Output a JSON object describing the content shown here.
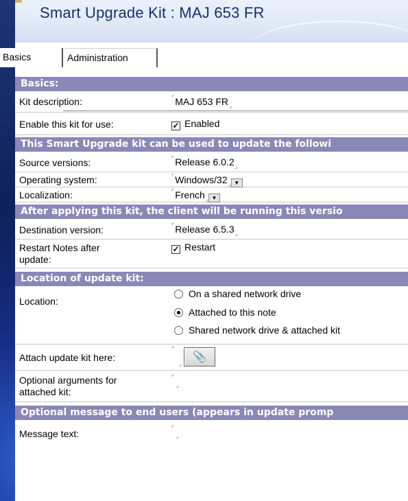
{
  "title": "Smart Upgrade Kit : MAJ 653 FR",
  "tabs": [
    {
      "label": "Basics"
    },
    {
      "label": "Administration"
    }
  ],
  "sections": {
    "basics": "Basics:",
    "update_following": "This Smart Upgrade kit can be used to update the followi",
    "client_version": "After applying this kit, the client will be running this versio",
    "location": "Location of update kit:",
    "optional_message": "Optional message to end users (appears in update promp"
  },
  "fields": {
    "kit_description": {
      "label": "Kit description:",
      "value": "MAJ 653 FR"
    },
    "enable_kit": {
      "label": "Enable this kit for use:",
      "option": "Enabled",
      "checked": true
    },
    "source_versions": {
      "label": "Source versions:",
      "value": "Release 6.0.2"
    },
    "operating_system": {
      "label": "Operating system:",
      "value": "Windows/32"
    },
    "localization": {
      "label": "Localization:",
      "value": "French"
    },
    "destination_version": {
      "label": "Destination version:",
      "value": "Release 6.5.3"
    },
    "restart_notes": {
      "label_line1": "Restart Notes after",
      "label_line2": "update:",
      "option": "Restart",
      "checked": true
    },
    "location": {
      "label": "Location:",
      "options": [
        "On a shared network drive",
        "Attached to this note",
        "Shared network drive & attached kit"
      ],
      "selected": "Attached to this note"
    },
    "attach_kit": {
      "label": "Attach update kit here:"
    },
    "optional_args": {
      "label_line1": "Optional arguments for",
      "label_line2": "attached kit:",
      "value": ""
    },
    "message_text": {
      "label": "Message text:",
      "value": ""
    }
  },
  "icons": {
    "dropdown": "dropdown-arrow-icon",
    "attach": "paperclip-attachment-icon",
    "checkmark": "checkmark-icon"
  },
  "colors": {
    "section_header_bg": "#8a88b6",
    "title_text": "#1b2f68",
    "desktop_bg": "#0b1b52"
  }
}
